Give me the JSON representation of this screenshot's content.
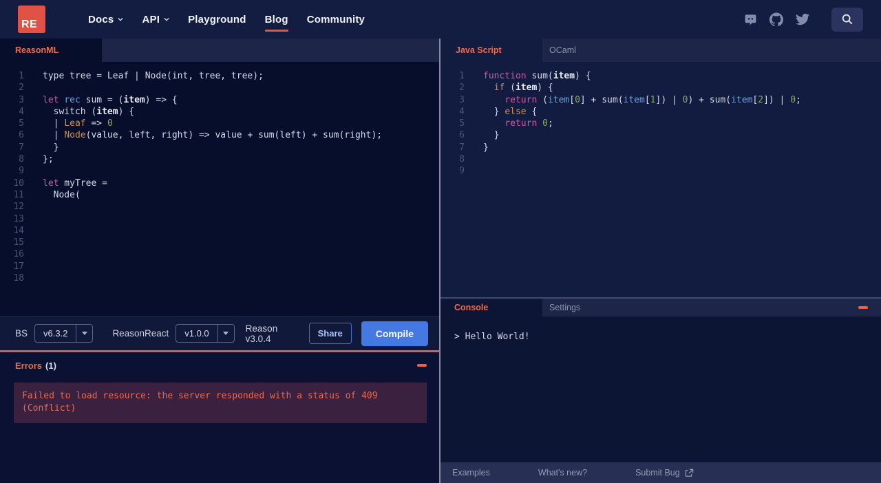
{
  "nav": {
    "logo_text": "RE",
    "items": [
      {
        "label": "Docs",
        "chevron": true,
        "active": false
      },
      {
        "label": "API",
        "chevron": true,
        "active": false
      },
      {
        "label": "Playground",
        "chevron": false,
        "active": false
      },
      {
        "label": "Blog",
        "chevron": false,
        "active": true
      },
      {
        "label": "Community",
        "chevron": false,
        "active": false
      }
    ],
    "icons": [
      "discord-icon",
      "github-icon",
      "twitter-icon",
      "search-icon"
    ]
  },
  "left_panel": {
    "tab_label": "ReasonML",
    "code": {
      "total_lines": 18,
      "lines": [
        [
          [
            "w",
            "type tree = Leaf | Node(int, tree, tree);"
          ]
        ],
        [],
        [
          [
            "m",
            "let"
          ],
          [
            "w",
            " "
          ],
          [
            "b",
            "rec"
          ],
          [
            "w",
            " sum = ("
          ],
          [
            "d",
            "item"
          ],
          [
            "w",
            ") => {"
          ]
        ],
        [
          [
            "w",
            "  switch ("
          ],
          [
            "d",
            "item"
          ],
          [
            "w",
            ") {"
          ]
        ],
        [
          [
            "w",
            "  | "
          ],
          [
            "o",
            "Leaf"
          ],
          [
            "w",
            " => "
          ],
          [
            "g",
            "0"
          ]
        ],
        [
          [
            "w",
            "  | "
          ],
          [
            "o",
            "Node"
          ],
          [
            "w",
            "(value, left, right) => value + sum(left) + sum(right);"
          ]
        ],
        [
          [
            "w",
            "  }"
          ]
        ],
        [
          [
            "w",
            "};"
          ]
        ],
        [],
        [
          [
            "m",
            "let"
          ],
          [
            "w",
            " myTree ="
          ]
        ],
        [
          [
            "w",
            "  Node("
          ]
        ]
      ]
    },
    "toolbar": {
      "bs_label": "BS",
      "bs_version": "v6.3.2",
      "reasonreact_label": "ReasonReact",
      "reasonreact_version": "v1.0.0",
      "reason_version": "Reason v3.0.4",
      "share_label": "Share",
      "compile_label": "Compile"
    },
    "errors": {
      "title": "Errors",
      "count": "(1)",
      "message": "Failed to load resource: the server responded with a status of 409 (Conflict)"
    }
  },
  "right_panel": {
    "tabs": {
      "active": "Java Script",
      "inactive": "OCaml"
    },
    "code": {
      "total_lines": 9,
      "lines": [
        [
          [
            "m",
            "function"
          ],
          [
            "w",
            " sum("
          ],
          [
            "d",
            "item"
          ],
          [
            "w",
            ") {"
          ]
        ],
        [
          [
            "w",
            "  "
          ],
          [
            "o",
            "if"
          ],
          [
            "w",
            " ("
          ],
          [
            "d",
            "item"
          ],
          [
            "w",
            ") {"
          ]
        ],
        [
          [
            "w",
            "    "
          ],
          [
            "m",
            "return"
          ],
          [
            "w",
            " ("
          ],
          [
            "b",
            "item"
          ],
          [
            "w",
            "["
          ],
          [
            "g",
            "0"
          ],
          [
            "w",
            "] + sum("
          ],
          [
            "b",
            "item"
          ],
          [
            "w",
            "["
          ],
          [
            "g",
            "1"
          ],
          [
            "w",
            "]) | "
          ],
          [
            "g",
            "0"
          ],
          [
            "w",
            ") + sum("
          ],
          [
            "b",
            "item"
          ],
          [
            "w",
            "["
          ],
          [
            "g",
            "2"
          ],
          [
            "w",
            "]) | "
          ],
          [
            "g",
            "0"
          ],
          [
            "w",
            ";"
          ]
        ],
        [
          [
            "w",
            "  } "
          ],
          [
            "o",
            "else"
          ],
          [
            "w",
            " {"
          ]
        ],
        [
          [
            "w",
            "    "
          ],
          [
            "m",
            "return"
          ],
          [
            "w",
            " "
          ],
          [
            "g",
            "0"
          ],
          [
            "w",
            ";"
          ]
        ],
        [
          [
            "w",
            "  }"
          ]
        ],
        [
          [
            "w",
            "}"
          ]
        ]
      ]
    },
    "console": {
      "active_tab": "Console",
      "inactive_tab": "Settings",
      "output": "> Hello World!"
    },
    "footer": {
      "examples": "Examples",
      "whats_new": "What's new?",
      "submit_bug": "Submit Bug"
    }
  },
  "colors": {
    "accent_orange": "#ed6c4b",
    "accent_border_orange": "#e8593d",
    "logo_red": "#e05244",
    "button_blue": "#4479e4",
    "error_box_bg": "#3a2140",
    "navbar_bg": "#131c41",
    "left_editor_bg": "#070e2c",
    "right_editor_bg": "#121c40"
  }
}
